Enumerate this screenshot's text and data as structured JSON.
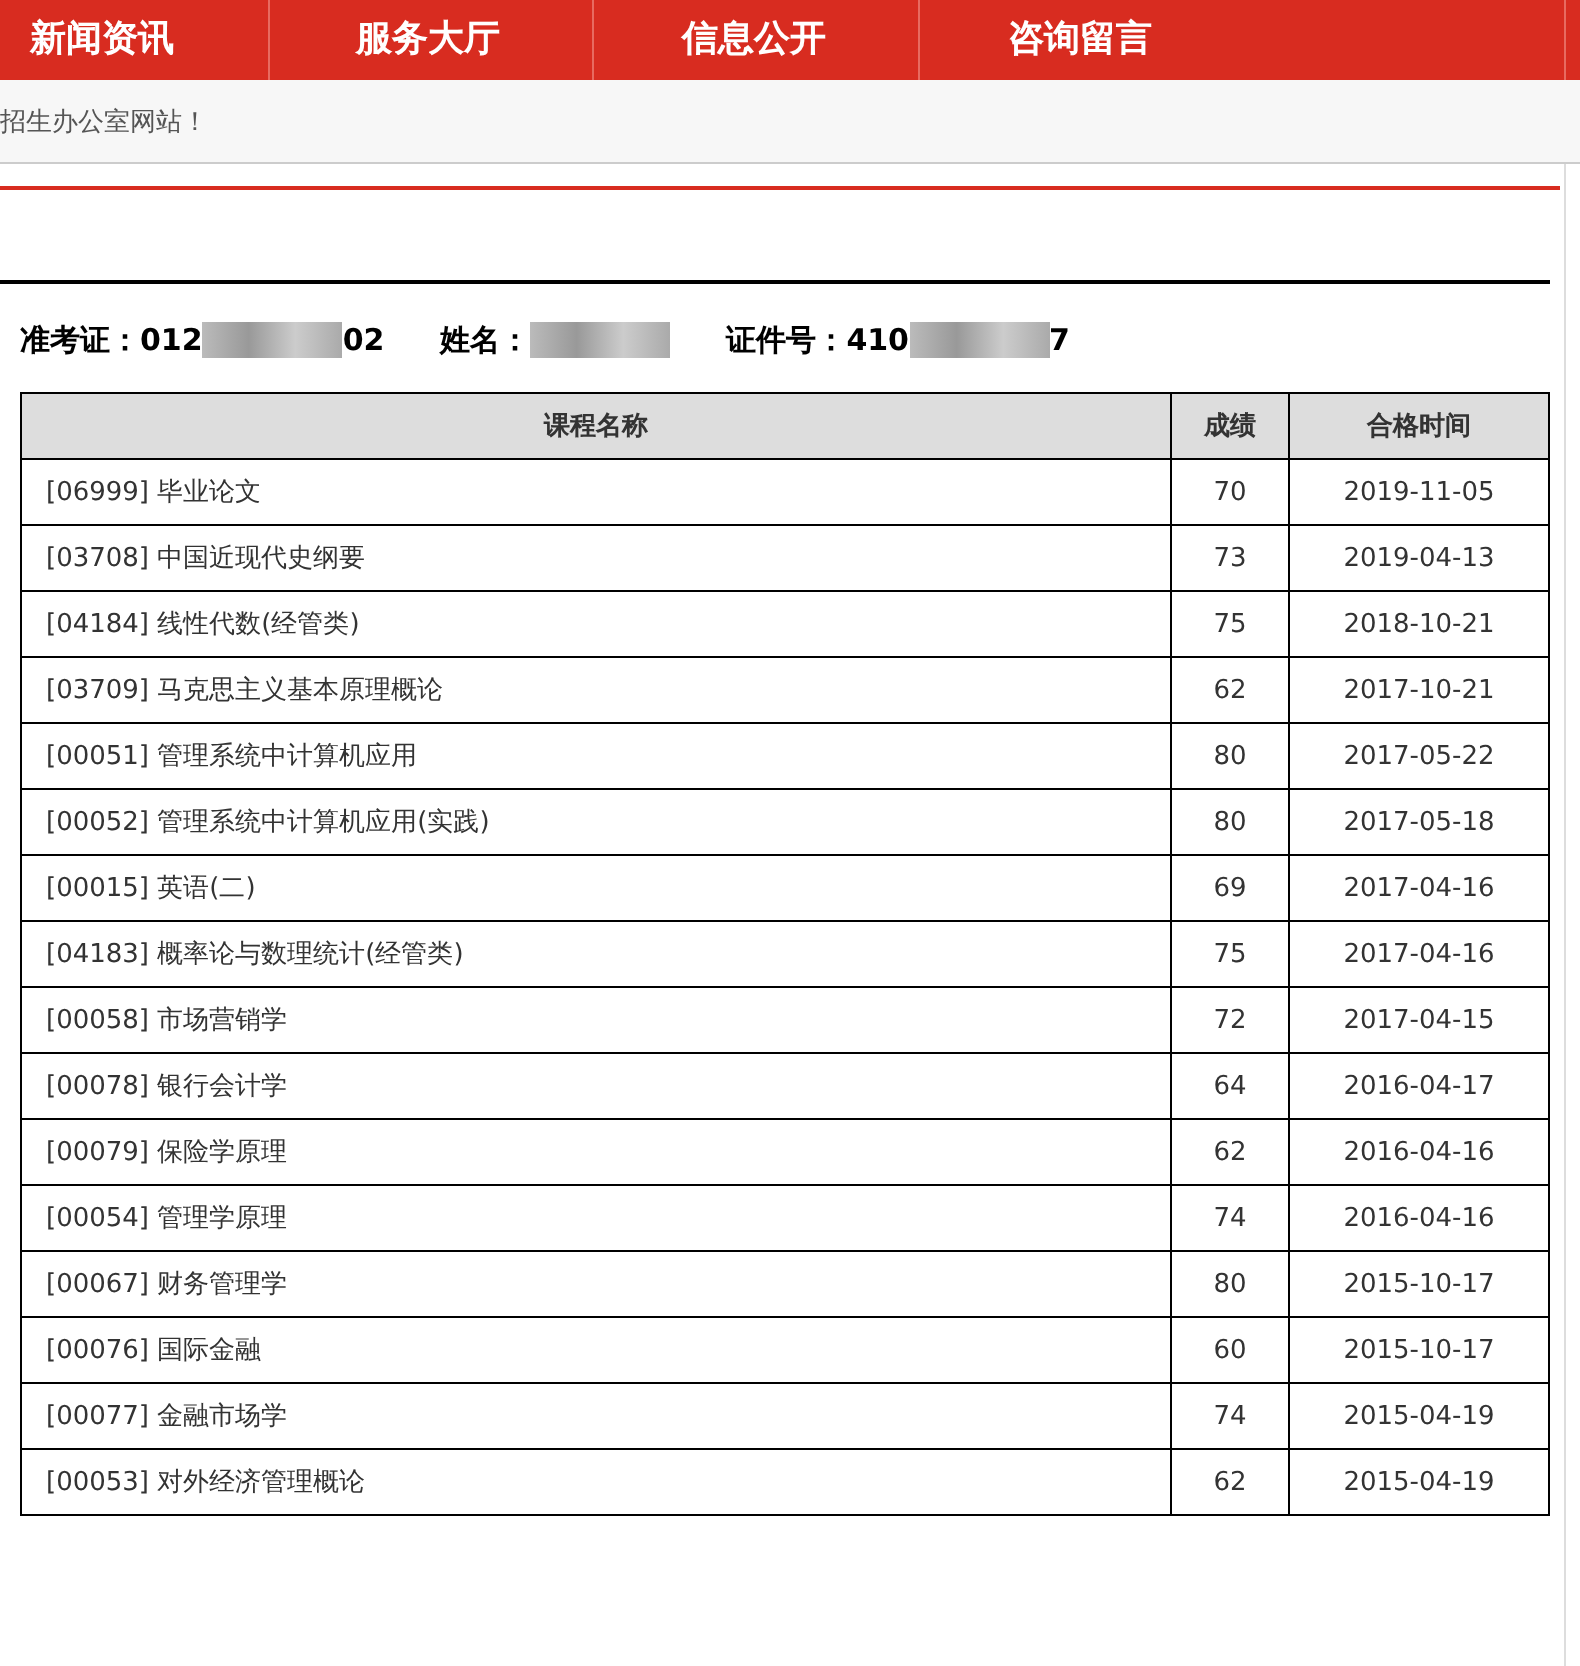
{
  "nav": [
    {
      "label": "新闻资讯"
    },
    {
      "label": "服务大厅"
    },
    {
      "label": "信息公开"
    },
    {
      "label": "咨询留言"
    }
  ],
  "notice": "招生办公室网站！",
  "info": [
    {
      "label": "准考证：",
      "start": "012",
      "end": "02",
      "redacted": true
    },
    {
      "label": "姓名：",
      "redacted": true
    },
    {
      "label": "证件号：",
      "start": "410",
      "end": "7",
      "redacted": true
    }
  ],
  "table": {
    "columns": [
      "课程名称",
      "成绩",
      "合格时间"
    ],
    "rows": [
      [
        "[06999] 毕业论文",
        "70",
        "2019-11-05"
      ],
      [
        "[03708] 中国近现代史纲要",
        "73",
        "2019-04-13"
      ],
      [
        "[04184] 线性代数(经管类)",
        "75",
        "2018-10-21"
      ],
      [
        "[03709] 马克思主义基本原理概论",
        "62",
        "2017-10-21"
      ],
      [
        "[00051] 管理系统中计算机应用",
        "80",
        "2017-05-22"
      ],
      [
        "[00052] 管理系统中计算机应用(实践)",
        "80",
        "2017-05-18"
      ],
      [
        "[00015] 英语(二)",
        "69",
        "2017-04-16"
      ],
      [
        "[04183] 概率论与数理统计(经管类)",
        "75",
        "2017-04-16"
      ],
      [
        "[00058] 市场营销学",
        "72",
        "2017-04-15"
      ],
      [
        "[00078] 银行会计学",
        "64",
        "2016-04-17"
      ],
      [
        "[00079] 保险学原理",
        "62",
        "2016-04-16"
      ],
      [
        "[00054] 管理学原理",
        "74",
        "2016-04-16"
      ],
      [
        "[00067] 财务管理学",
        "80",
        "2015-10-17"
      ],
      [
        "[00076] 国际金融",
        "60",
        "2015-10-17"
      ],
      [
        "[00077] 金融市场学",
        "74",
        "2015-04-19"
      ],
      [
        "[00053] 对外经济管理概论",
        "62",
        "2015-04-19"
      ]
    ]
  }
}
